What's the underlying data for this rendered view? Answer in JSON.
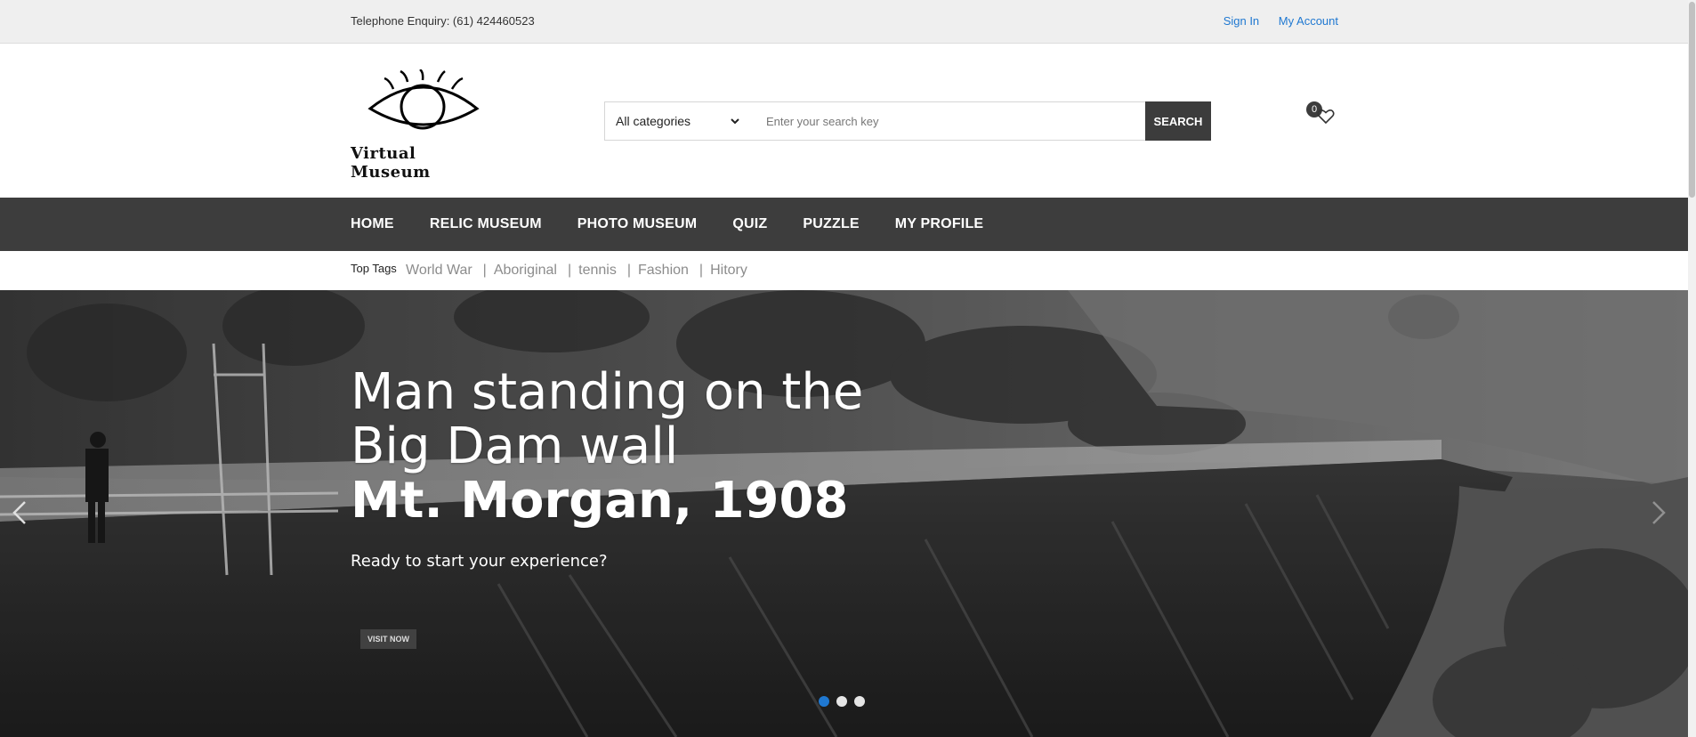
{
  "topbar": {
    "phone": "Telephone Enquiry: (61) 424460523",
    "sign_in": "Sign In",
    "my_account": "My Account"
  },
  "header": {
    "logo_text": "Virtual Museum",
    "search": {
      "category": "All categories",
      "placeholder": "Enter your search key",
      "button": "SEARCH"
    },
    "wishlist_count": "0"
  },
  "nav": {
    "items": [
      "HOME",
      "RELIC MUSEUM",
      "PHOTO MUSEUM",
      "QUIZ",
      "PUZZLE",
      "MY PROFILE"
    ]
  },
  "tags": {
    "label": "Top Tags",
    "items": [
      "World War",
      "Aboriginal",
      "tennis",
      "Fashion",
      "Hitory"
    ]
  },
  "hero": {
    "title_line1": "Man standing on the",
    "title_line2": "Big Dam wall",
    "title_line3": "Mt. Morgan, 1908",
    "subtitle": "Ready to start your experience?",
    "button": "VISIT NOW",
    "slides": 3,
    "active_slide": 1
  },
  "colors": {
    "accent": "#1f78d1",
    "nav_bg": "#3d3d3d",
    "topbar_bg": "#efefef"
  },
  "icons": [
    "eye-logo-icon",
    "chevron-down-icon",
    "heart-icon",
    "chevron-left-icon",
    "chevron-right-icon"
  ]
}
